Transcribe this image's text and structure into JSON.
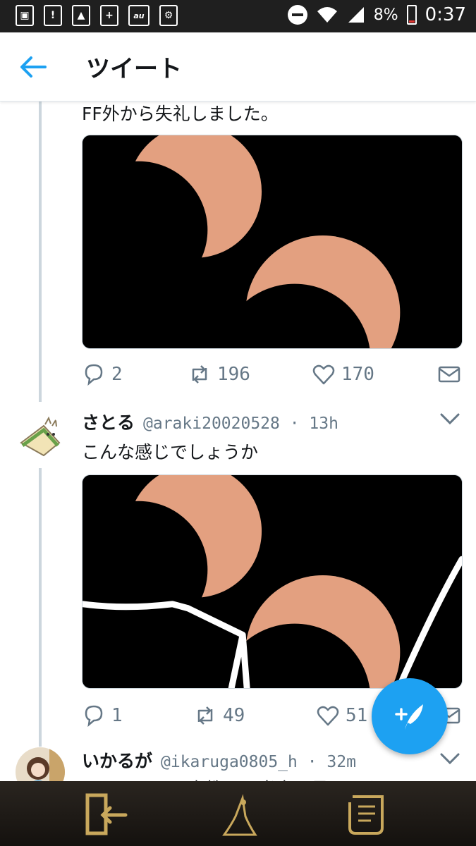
{
  "status_bar": {
    "left_icons": [
      "contacts-icon",
      "alert-icon",
      "image-icon",
      "battery-saver-icon",
      "au-icon",
      "nfc-icon"
    ],
    "battery": "8%",
    "time": "0:37"
  },
  "header": {
    "title": "ツイート"
  },
  "tweets": [
    {
      "text": "FF外から失礼しました。",
      "actions": {
        "replies": "2",
        "retweets": "196",
        "likes": "170"
      }
    },
    {
      "display_name": "さとる",
      "handle": "@araki20020528 · 13h",
      "text": "こんな感じでしょうか",
      "actions": {
        "replies": "1",
        "retweets": "49",
        "likes": "51"
      }
    },
    {
      "display_name": "いかるが",
      "handle": "@ikaruga0805_h · 32m",
      "text": "だんだん西川貴教の面当良に見えてきました"
    }
  ],
  "colors": {
    "accent": "#1da1f2",
    "muted": "#657786",
    "sun": "#e3a080"
  }
}
